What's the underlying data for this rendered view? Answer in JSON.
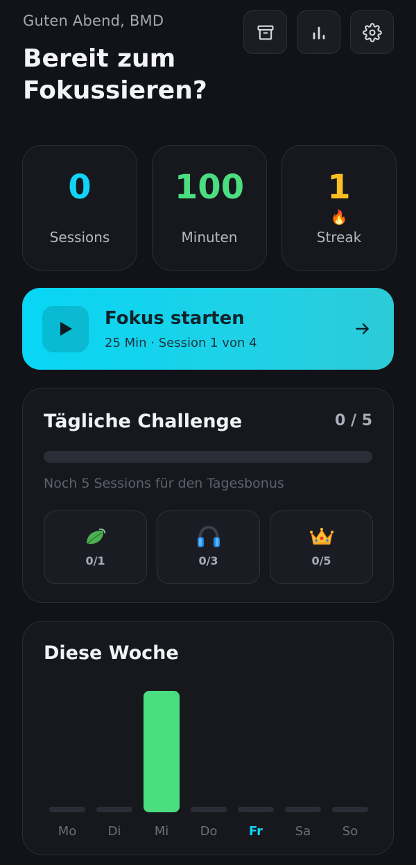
{
  "header": {
    "greeting": "Guten Abend, BMD",
    "title": "Bereit zum Fokussieren?",
    "buttons": [
      {
        "icon": "archive-icon"
      },
      {
        "icon": "stats-icon"
      },
      {
        "icon": "gear-icon"
      }
    ]
  },
  "stats": {
    "sessions": {
      "value": "0",
      "label": "Sessions",
      "color": "#0fd4f7"
    },
    "minutes": {
      "value": "100",
      "label": "Minuten",
      "color": "#4ade80"
    },
    "streak": {
      "value": "1",
      "label": "Streak",
      "emoji": "🔥",
      "color": "#fbbf24"
    }
  },
  "focus": {
    "title": "Fokus starten",
    "subtitle": "25 Min · Session 1 von 4"
  },
  "challenge": {
    "title": "Tägliche Challenge",
    "count": "0 / 5",
    "progress": 0,
    "hint": "Noch 5 Sessions für den Tagesbonus",
    "tiles": [
      {
        "icon": "leaf-icon",
        "value": "0/1"
      },
      {
        "icon": "headphones-icon",
        "value": "0/3"
      },
      {
        "icon": "crown-icon",
        "value": "0/5"
      }
    ]
  },
  "week": {
    "title": "Diese Woche",
    "today": "Fr",
    "chart_data": {
      "type": "bar",
      "categories": [
        "Mo",
        "Di",
        "Mi",
        "Do",
        "Fr",
        "Sa",
        "So"
      ],
      "values": [
        0,
        0,
        100,
        0,
        0,
        0,
        0
      ],
      "bar_color": "#4ade80",
      "empty_color": "#2a2c36",
      "today_color": "#0fd4f7"
    }
  }
}
